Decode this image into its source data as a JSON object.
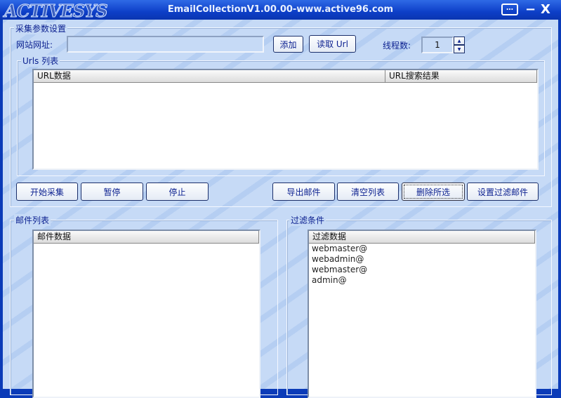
{
  "window": {
    "logo": "ACTIVESYS",
    "title": "EmailCollectionV1.00.00-www.active96.com",
    "chat": "…",
    "minimize": "−",
    "close": "X"
  },
  "params": {
    "legend": "采集参数设置",
    "url_label": "网站网址:",
    "url_value": "",
    "add": "添加",
    "read_url": "读取 Url",
    "threads_label": "线程数:",
    "threads_value": "1",
    "spin_up": "▲",
    "spin_down": "▼"
  },
  "urls": {
    "legend": "Urls 列表",
    "columns": [
      "URL数据",
      "URL搜索结果"
    ]
  },
  "buttons": {
    "start": "开始采集",
    "pause": "暂停",
    "stop": "停止",
    "export": "导出邮件",
    "clear": "清空列表",
    "delete": "删除所选",
    "set_filter": "设置过滤邮件"
  },
  "mail": {
    "legend": "邮件列表",
    "column": "邮件数据"
  },
  "filter": {
    "legend": "过滤条件",
    "column": "过滤数据",
    "rows": [
      "webmaster@",
      "webadmin@",
      "webmaster@",
      "admin@"
    ]
  }
}
